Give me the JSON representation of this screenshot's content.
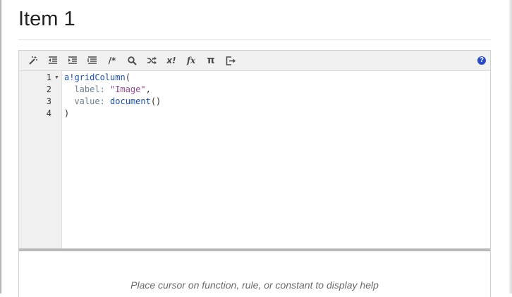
{
  "page": {
    "title": "Item 1"
  },
  "toolbar": {
    "buttons": [
      {
        "name": "format-wand",
        "icon": "magic-wand-icon"
      },
      {
        "name": "outdent",
        "icon": "outdent-icon"
      },
      {
        "name": "indent",
        "icon": "indent-icon"
      },
      {
        "name": "auto-indent",
        "icon": "align-lines-icon"
      },
      {
        "name": "comment",
        "icon": "comment-icon",
        "text": "/*"
      },
      {
        "name": "search",
        "icon": "search-icon"
      },
      {
        "name": "shuffle",
        "icon": "shuffle-icon"
      },
      {
        "name": "expression",
        "icon": "x-bang-icon",
        "text": "x!"
      },
      {
        "name": "functions",
        "icon": "fx-icon",
        "text": "fx"
      },
      {
        "name": "constants",
        "icon": "pi-icon",
        "text": "π"
      },
      {
        "name": "export",
        "icon": "export-icon"
      }
    ],
    "help_label": "?"
  },
  "editor": {
    "line_numbers": [
      "1",
      "2",
      "3",
      "4"
    ],
    "lines": [
      {
        "indent": "",
        "tokens": [
          {
            "t": "a!gridColumn",
            "c": "fn"
          },
          {
            "t": "(",
            "c": "plain"
          }
        ]
      },
      {
        "indent": "  ",
        "tokens": [
          {
            "t": "label",
            "c": "key"
          },
          {
            "t": ": ",
            "c": "key"
          },
          {
            "t": "\"Image\"",
            "c": "str"
          },
          {
            "t": ",",
            "c": "plain"
          }
        ]
      },
      {
        "indent": "  ",
        "tokens": [
          {
            "t": "value",
            "c": "key"
          },
          {
            "t": ": ",
            "c": "key"
          },
          {
            "t": "document",
            "c": "fn"
          },
          {
            "t": "()",
            "c": "plain"
          }
        ]
      },
      {
        "indent": "",
        "tokens": [
          {
            "t": ")",
            "c": "plain"
          }
        ]
      }
    ]
  },
  "help_panel": {
    "message": "Place cursor on function, rule, or constant to display help"
  },
  "colors": {
    "accent": "#2a49c4",
    "string": "#8e4a8e",
    "function": "#1f4fa3"
  }
}
